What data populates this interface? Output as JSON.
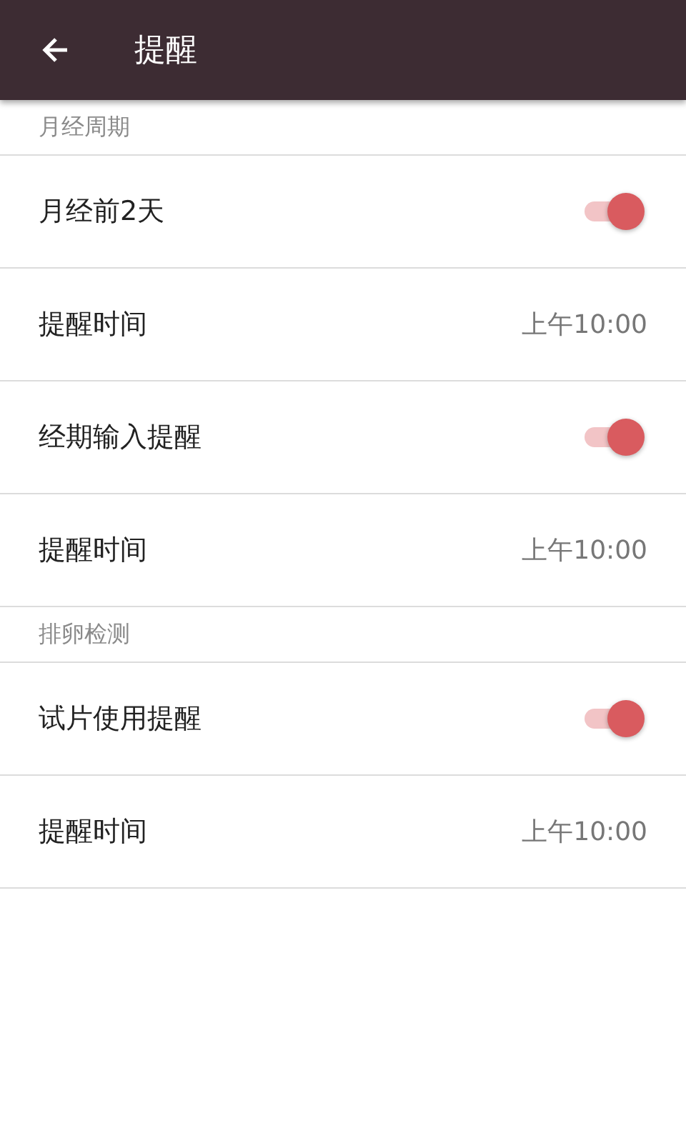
{
  "app_bar": {
    "title": "提醒"
  },
  "sections": [
    {
      "header": "月经周期",
      "rows": [
        {
          "kind": "toggle",
          "label": "月经前2天",
          "on": true
        },
        {
          "kind": "value",
          "label": "提醒时间",
          "value": "上午10:00"
        },
        {
          "kind": "toggle",
          "label": "经期输入提醒",
          "on": true
        },
        {
          "kind": "value",
          "label": "提醒时间",
          "value": "上午10:00"
        }
      ]
    },
    {
      "header": "排卵检测",
      "rows": [
        {
          "kind": "toggle",
          "label": "试片使用提醒",
          "on": true
        },
        {
          "kind": "value",
          "label": "提醒时间",
          "value": "上午10:00"
        }
      ]
    }
  ]
}
